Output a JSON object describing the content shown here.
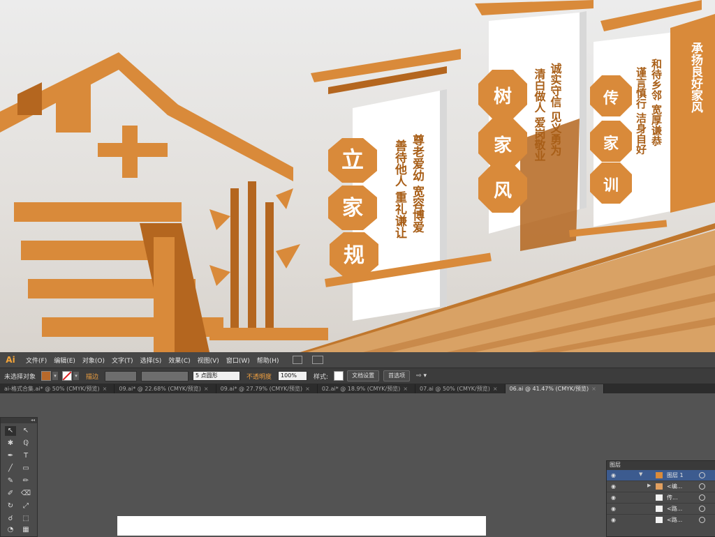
{
  "scene": {
    "boards": [
      {
        "badge": [
          "立",
          "家",
          "规"
        ],
        "lines": [
          "尊老爱幼 宽容博爱",
          "善待他人 重礼谦让"
        ]
      },
      {
        "badge": [
          "树",
          "家",
          "风"
        ],
        "lines": [
          "诚实守信 见义勇为",
          "清白做人 爱岗敬业"
        ]
      },
      {
        "badge": [
          "传",
          "家",
          "训"
        ],
        "lines": [
          "和待乡邻 宽厚谦恭",
          "谨言慎行 洁身自好"
        ]
      }
    ],
    "partial_board_text": "承扬良好家风",
    "colors": {
      "wood": "#d98a3a",
      "wood_dark": "#b4661f",
      "wall": "#e8e6e3"
    }
  },
  "app": {
    "logo": "Ai",
    "menus": [
      "文件(F)",
      "编辑(E)",
      "对象(O)",
      "文字(T)",
      "选择(S)",
      "效果(C)",
      "视图(V)",
      "窗口(W)",
      "帮助(H)"
    ],
    "control": {
      "selection": "未选择对象",
      "stroke_label": "描边",
      "point_shape": "5 点圆形",
      "opacity_label": "不透明度",
      "opacity_value": "100%",
      "style_label": "样式:",
      "doc_setup": "文档设置",
      "preferences": "首选项"
    },
    "tabs": [
      {
        "label": "ai-格式合集.ai* @ 50% (CMYK/预览)",
        "active": false
      },
      {
        "label": "09.ai* @ 22.68% (CMYK/预览)",
        "active": false
      },
      {
        "label": "09.ai* @ 27.79% (CMYK/预览)",
        "active": false
      },
      {
        "label": "02.ai* @ 18.9% (CMYK/预览)",
        "active": false
      },
      {
        "label": "07.ai @ 50% (CMYK/预览)",
        "active": false
      },
      {
        "label": "06.ai @ 41.47% (CMYK/预览)",
        "active": true
      }
    ],
    "layers_panel": {
      "title": "图层",
      "rows": [
        {
          "name": "图层 1",
          "selected": true
        },
        {
          "name": "<编...",
          "selected": false
        },
        {
          "name": "传...",
          "selected": false
        },
        {
          "name": "<路...",
          "selected": false
        },
        {
          "name": "<路...",
          "selected": false
        }
      ]
    }
  }
}
